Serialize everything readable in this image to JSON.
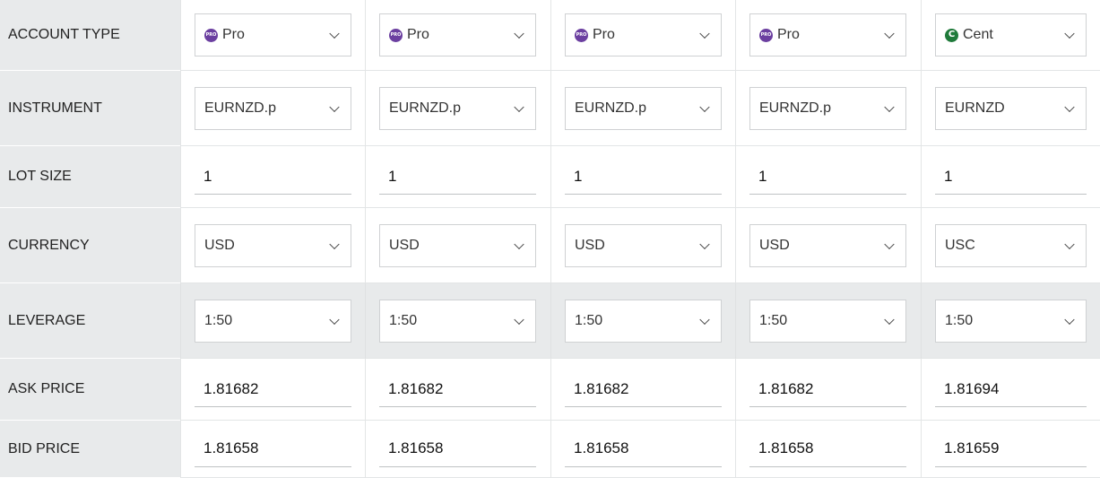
{
  "rows": [
    {
      "label": "ACCOUNT TYPE"
    },
    {
      "label": "INSTRUMENT"
    },
    {
      "label": "LOT SIZE"
    },
    {
      "label": "CURRENCY"
    },
    {
      "label": "LEVERAGE"
    },
    {
      "label": "ASK PRICE"
    },
    {
      "label": "BID PRICE"
    }
  ],
  "columns": [
    {
      "account_type": "Pro",
      "account_icon": "pro-badge-icon",
      "account_badge_text": "PRO",
      "instrument": "EURNZD.p",
      "lot_size": "1",
      "currency": "USD",
      "leverage": "1:50",
      "ask": "1.81682",
      "bid": "1.81658"
    },
    {
      "account_type": "Pro",
      "account_icon": "pro-badge-icon",
      "account_badge_text": "PRO",
      "instrument": "EURNZD.p",
      "lot_size": "1",
      "currency": "USD",
      "leverage": "1:50",
      "ask": "1.81682",
      "bid": "1.81658"
    },
    {
      "account_type": "Pro",
      "account_icon": "pro-badge-icon",
      "account_badge_text": "PRO",
      "instrument": "EURNZD.p",
      "lot_size": "1",
      "currency": "USD",
      "leverage": "1:50",
      "ask": "1.81682",
      "bid": "1.81658"
    },
    {
      "account_type": "Pro",
      "account_icon": "pro-badge-icon",
      "account_badge_text": "PRO",
      "instrument": "EURNZD.p",
      "lot_size": "1",
      "currency": "USD",
      "leverage": "1:50",
      "ask": "1.81682",
      "bid": "1.81658"
    },
    {
      "account_type": "Cent",
      "account_icon": "cent-badge-icon",
      "account_badge_text": "C",
      "instrument": "EURNZD",
      "lot_size": "1",
      "currency": "USC",
      "leverage": "1:50",
      "ask": "1.81694",
      "bid": "1.81659"
    }
  ],
  "colors": {
    "pro_badge": "#6b3fa0",
    "cent_badge": "#1f7a3a",
    "label_bg": "#e8eaeb"
  }
}
